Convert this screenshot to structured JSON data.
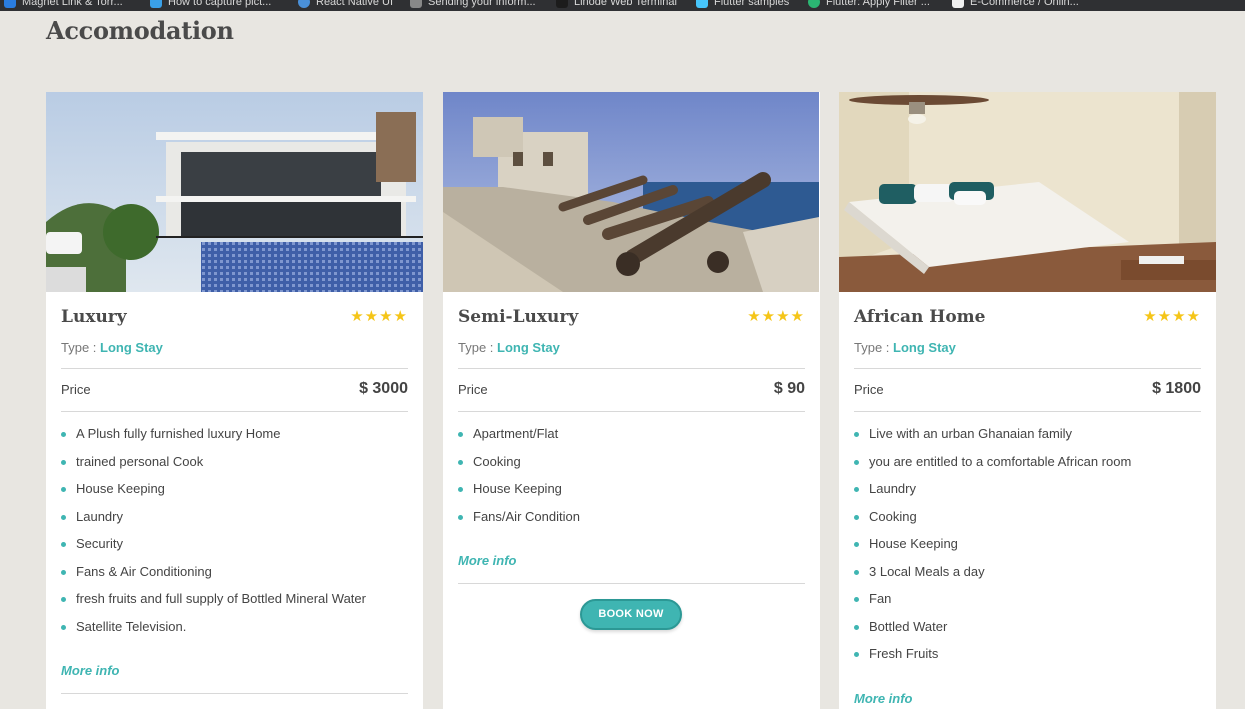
{
  "bookmarks": [
    {
      "label": "Magnet Link & Torr...",
      "icon": "blue-x-icon"
    },
    {
      "label": "How to capture pict...",
      "icon": "grid-icon"
    },
    {
      "label": "React Native UI",
      "icon": "circle-icon"
    },
    {
      "label": "Sending your inform...",
      "icon": "doc-icon"
    },
    {
      "label": "Linode Web Terminal",
      "icon": "terminal-icon"
    },
    {
      "label": "Flutter samples",
      "icon": "flutter-icon"
    },
    {
      "label": "Flutter: Apply Filter ...",
      "icon": "green-icon"
    },
    {
      "label": "E-Commerce / Onlin...",
      "icon": "page-icon"
    }
  ],
  "page": {
    "title": "Accomodation"
  },
  "labels": {
    "type": "Type :",
    "price": "Price",
    "more_info": "More info",
    "book_now": "BOOK NOW"
  },
  "rating_stars": "★★★★",
  "cards": [
    {
      "title": "Luxury",
      "rating": 4,
      "type": "Long Stay",
      "price": "$ 3000",
      "image": "modern-villa-photo",
      "features": [
        "A Plush fully furnished luxury Home",
        "trained personal Cook",
        "House Keeping",
        "Laundry",
        "Security",
        "Fans & Air Conditioning",
        "fresh fruits and full supply of Bottled Mineral Water",
        "Satellite Television."
      ]
    },
    {
      "title": "Semi-Luxury",
      "rating": 4,
      "type": "Long Stay",
      "price": "$ 90",
      "image": "fort-cannons-photo",
      "features": [
        "Apartment/Flat",
        "Cooking",
        "House Keeping",
        "Fans/Air Condition"
      ]
    },
    {
      "title": "African Home",
      "rating": 4,
      "type": "Long Stay",
      "price": "$ 1800",
      "image": "bedroom-photo",
      "features": [
        "Live with an urban Ghanaian family",
        "you are entitled to a comfortable African room",
        "Laundry",
        "Cooking",
        "House Keeping",
        "3 Local Meals a day",
        "Fan",
        "Bottled Water",
        "Fresh Fruits"
      ]
    }
  ],
  "colors": {
    "accent": "#3fb5b2",
    "stars": "#f5c518",
    "background": "#e8e6e1"
  }
}
